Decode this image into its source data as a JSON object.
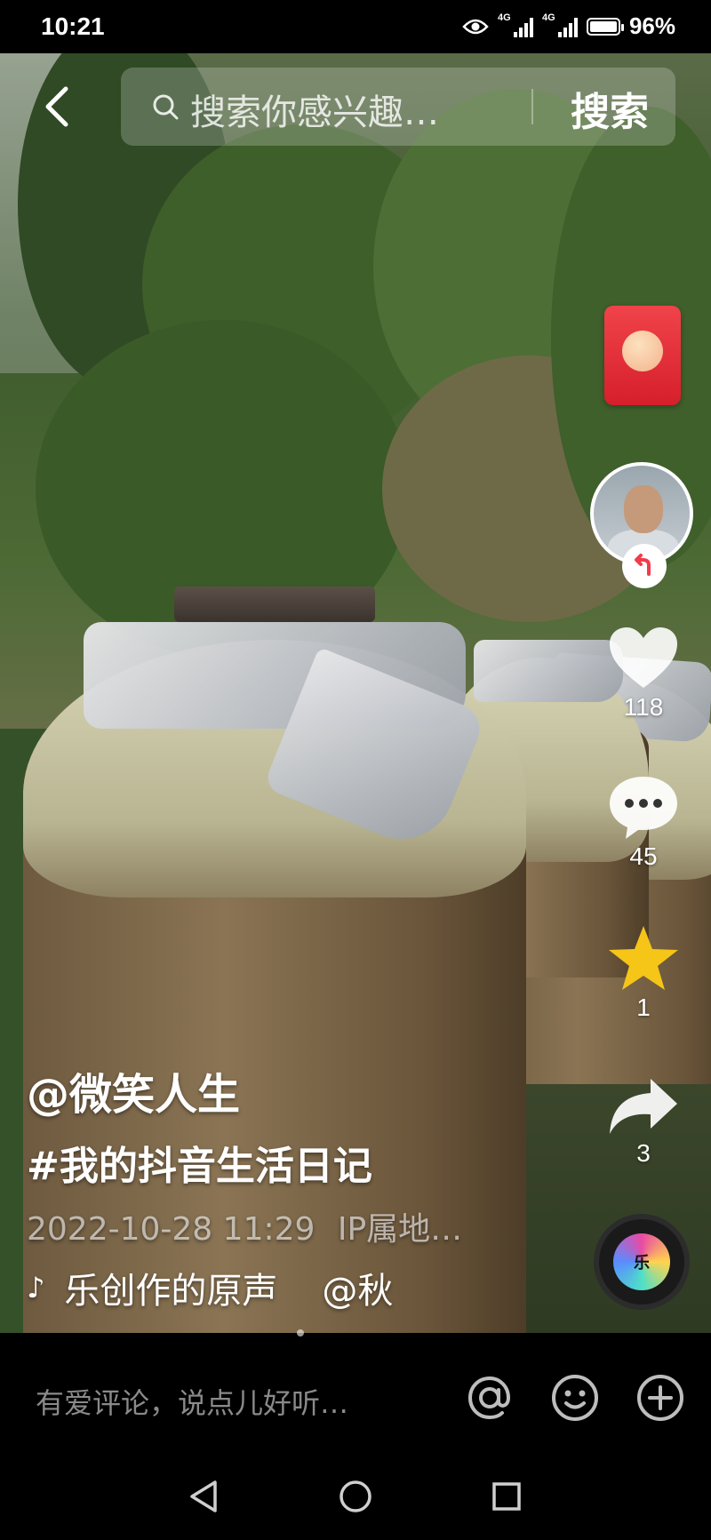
{
  "status_bar": {
    "time": "10:21",
    "network_1": "4G",
    "network_2": "4G",
    "battery": "96%"
  },
  "search": {
    "placeholder": "搜索你感兴趣…",
    "button_label": "搜索"
  },
  "video": {
    "author": "@微笑人生",
    "hashtag": "#我的抖音生活日记",
    "timestamp": "2022-10-28 11:29",
    "ip_location": "IP属地…",
    "music_title": "乐创作的原声",
    "music_author": "@秋",
    "disc_label": "乐"
  },
  "actions": {
    "likes": "118",
    "comments": "45",
    "favorites": "1",
    "shares": "3"
  },
  "comment_bar": {
    "placeholder": "有爱评论，说点儿好听…"
  },
  "colors": {
    "favorite_star": "#f5c518",
    "red_packet": "#e12c36"
  }
}
